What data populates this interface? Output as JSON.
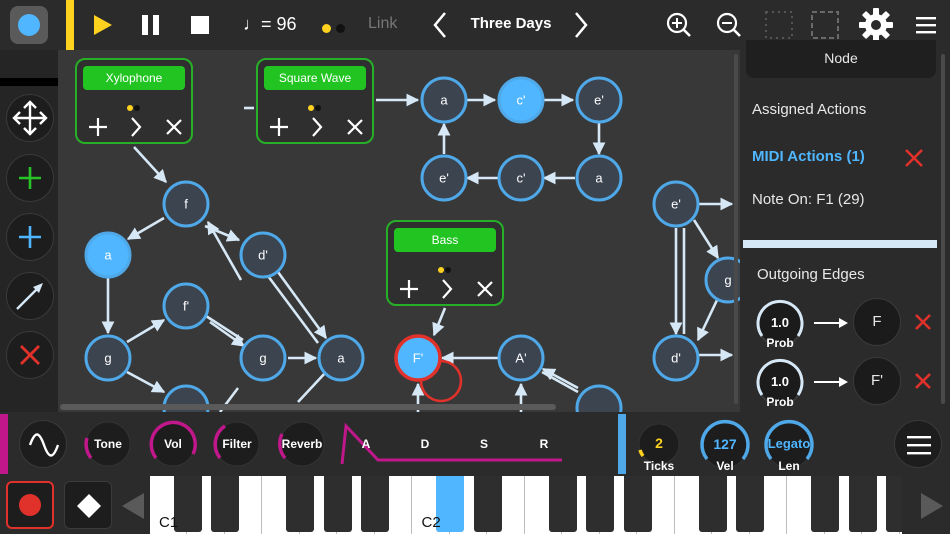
{
  "colors": {
    "accent_blue": "#4fb6ff",
    "node_fill": "#3c4450",
    "node_ring": "#4fa8e8",
    "green": "#27c427",
    "red": "#e0312a",
    "magenta": "#c0178b",
    "yellow": "#ffd21f",
    "edge": "#d6e8f6"
  },
  "topbar": {
    "status_icon": "record-status-icon",
    "tempo": "♩= 96",
    "link_label": "Link",
    "scene_title": "Three Days"
  },
  "voices": [
    {
      "name": "Xylophone"
    },
    {
      "name": "Square Wave"
    },
    {
      "name": "Bass"
    }
  ],
  "nodes": [
    {
      "label": "f"
    },
    {
      "label": "a"
    },
    {
      "label": "d'"
    },
    {
      "label": "f'"
    },
    {
      "label": "g"
    },
    {
      "label": "g"
    },
    {
      "label": "a"
    },
    {
      "label": "a"
    },
    {
      "label": "c'"
    },
    {
      "label": "e'"
    },
    {
      "label": "e'"
    },
    {
      "label": "c'"
    },
    {
      "label": "a"
    },
    {
      "label": "F'"
    },
    {
      "label": "A'"
    },
    {
      "label": "e'"
    },
    {
      "label": "g"
    },
    {
      "label": "d'"
    }
  ],
  "panel": {
    "node_header": "Node",
    "assigned_actions": "Assigned Actions",
    "midi_actions": "MIDI Actions (1)",
    "note_on": "Note On: F1 (29)",
    "outgoing_edges": "Outgoing Edges",
    "edges": [
      {
        "prob_value": "1.0",
        "prob_label": "Prob",
        "target": "F"
      },
      {
        "prob_value": "1.0",
        "prob_label": "Prob",
        "target": "F'"
      }
    ]
  },
  "controls": {
    "tone": "Tone",
    "vol": "Vol",
    "filter": "Filter",
    "reverb": "Reverb",
    "adsr": [
      "A",
      "D",
      "S",
      "R"
    ],
    "ticks_value": "2",
    "ticks_label": "Ticks",
    "vel_value": "127",
    "vel_label": "Vel",
    "len_value": "Legato",
    "len_label": "Len"
  },
  "keyboard": {
    "labels": [
      "C1",
      "C2"
    ]
  }
}
